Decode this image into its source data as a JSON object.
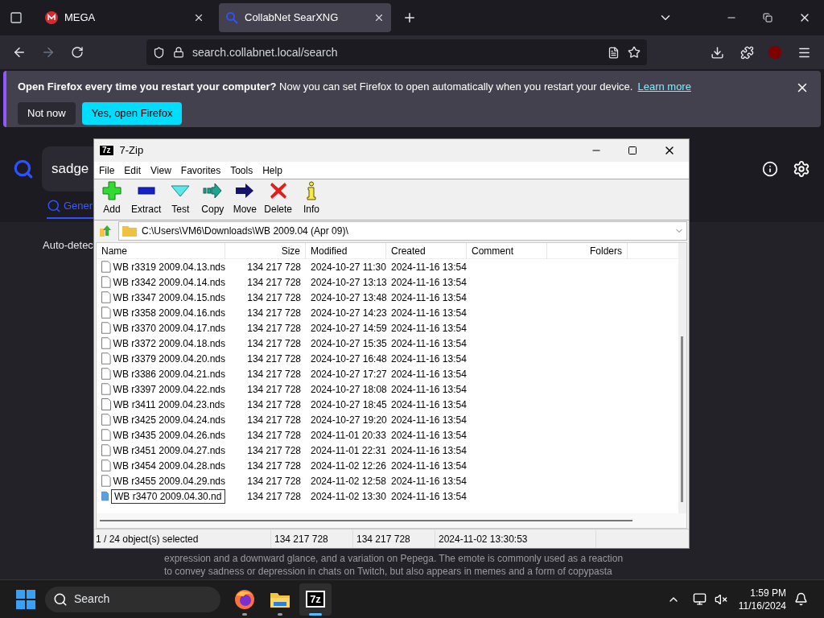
{
  "browser": {
    "tabs": [
      {
        "title": "MEGA",
        "selected": false
      },
      {
        "title": "CollabNet SearXNG",
        "selected": true
      }
    ],
    "url": "search.collabnet.local/search",
    "notification": {
      "message": "**Open Firefox every time you restart your computer?** Now you can set Firefox to open automatically when you restart your device.",
      "link": "Learn more",
      "buttons": [
        {
          "label": "Not now",
          "primary": false
        },
        {
          "label": "Yes, open Firefox",
          "primary": true
        }
      ]
    }
  },
  "page": {
    "query": "sadge",
    "tab": "Gener",
    "notice": "Auto-detec",
    "description": [
      "expression and a downward glance, and a variation on Pepega. The emote is commonly used as a reaction",
      "to convey sadness or depression in chats on Twitch, but also appears in memes and a form of copypasta"
    ]
  },
  "window": {
    "logo": "7z",
    "title": "7-Zip",
    "menu": [
      "File",
      "Edit",
      "View",
      "Favorites",
      "Tools",
      "Help"
    ],
    "toolbar": [
      {
        "label": "Add",
        "kind": "add"
      },
      {
        "label": "Extract",
        "kind": "extract"
      },
      {
        "label": "Test",
        "kind": "test"
      },
      {
        "label": "Copy",
        "kind": "copy"
      },
      {
        "label": "Move",
        "kind": "move"
      },
      {
        "label": "Delete",
        "kind": "delete"
      },
      {
        "label": "Info",
        "kind": "info"
      }
    ],
    "path": "C:\\Users\\VM6\\Downloads\\WB 2009.04 (Apr 09)\\",
    "columns": [
      "Name",
      "Size",
      "Modified",
      "Created",
      "Comment",
      "Folders"
    ],
    "rows": [
      {
        "name": "WB r3319 2009.04.13.nds",
        "size": "134 217 728",
        "modified": "2024-10-27 11:30",
        "created": "2024-11-16 13:54",
        "selected": false,
        "editing": false
      },
      {
        "name": "WB r3342 2009.04.14.nds",
        "size": "134 217 728",
        "modified": "2024-10-27 13:13",
        "created": "2024-11-16 13:54",
        "selected": false,
        "editing": false
      },
      {
        "name": "WB r3347 2009.04.15.nds",
        "size": "134 217 728",
        "modified": "2024-10-27 13:48",
        "created": "2024-11-16 13:54",
        "selected": false,
        "editing": false
      },
      {
        "name": "WB r3358 2009.04.16.nds",
        "size": "134 217 728",
        "modified": "2024-10-27 14:23",
        "created": "2024-11-16 13:54",
        "selected": false,
        "editing": false
      },
      {
        "name": "WB r3370 2009.04.17.nds",
        "size": "134 217 728",
        "modified": "2024-10-27 14:59",
        "created": "2024-11-16 13:54",
        "selected": false,
        "editing": false
      },
      {
        "name": "WB r3372 2009.04.18.nds",
        "size": "134 217 728",
        "modified": "2024-10-27 15:35",
        "created": "2024-11-16 13:54",
        "selected": false,
        "editing": false
      },
      {
        "name": "WB r3379 2009.04.20.nds",
        "size": "134 217 728",
        "modified": "2024-10-27 16:48",
        "created": "2024-11-16 13:54",
        "selected": false,
        "editing": false
      },
      {
        "name": "WB r3386 2009.04.21.nds",
        "size": "134 217 728",
        "modified": "2024-10-27 17:27",
        "created": "2024-11-16 13:54",
        "selected": false,
        "editing": false
      },
      {
        "name": "WB r3397 2009.04.22.nds",
        "size": "134 217 728",
        "modified": "2024-10-27 18:08",
        "created": "2024-11-16 13:54",
        "selected": false,
        "editing": false
      },
      {
        "name": "WB r3411 2009.04.23.nds",
        "size": "134 217 728",
        "modified": "2024-10-27 18:45",
        "created": "2024-11-16 13:54",
        "selected": false,
        "editing": false
      },
      {
        "name": "WB r3425 2009.04.24.nds",
        "size": "134 217 728",
        "modified": "2024-10-27 19:20",
        "created": "2024-11-16 13:54",
        "selected": false,
        "editing": false
      },
      {
        "name": "WB r3435 2009.04.26.nds",
        "size": "134 217 728",
        "modified": "2024-11-01 20:33",
        "created": "2024-11-16 13:54",
        "selected": false,
        "editing": false
      },
      {
        "name": "WB r3451 2009.04.27.nds",
        "size": "134 217 728",
        "modified": "2024-11-01 22:31",
        "created": "2024-11-16 13:54",
        "selected": false,
        "editing": false
      },
      {
        "name": "WB r3454 2009.04.28.nds",
        "size": "134 217 728",
        "modified": "2024-11-02 12:26",
        "created": "2024-11-16 13:54",
        "selected": false,
        "editing": false
      },
      {
        "name": "WB r3455 2009.04.29.nds",
        "size": "134 217 728",
        "modified": "2024-11-02 12:58",
        "created": "2024-11-16 13:54",
        "selected": false,
        "editing": false
      },
      {
        "name": "WB r3470 2009.04.30.nd",
        "size": "134 217 728",
        "modified": "2024-11-02 13:30",
        "created": "2024-11-16 13:54",
        "selected": true,
        "editing": true
      }
    ],
    "status": [
      "1 / 24 object(s) selected",
      "134 217 728",
      "134 217 728",
      "2024-11-02 13:30:53"
    ]
  },
  "taskbar": {
    "search": "Search",
    "apps": [
      {
        "kind": "firefox",
        "selected": false
      },
      {
        "kind": "files",
        "selected": false
      },
      {
        "kind": "archiver",
        "label": "7z",
        "selected": true
      }
    ],
    "time": "1:59 PM",
    "date": "11/16/2024"
  }
}
